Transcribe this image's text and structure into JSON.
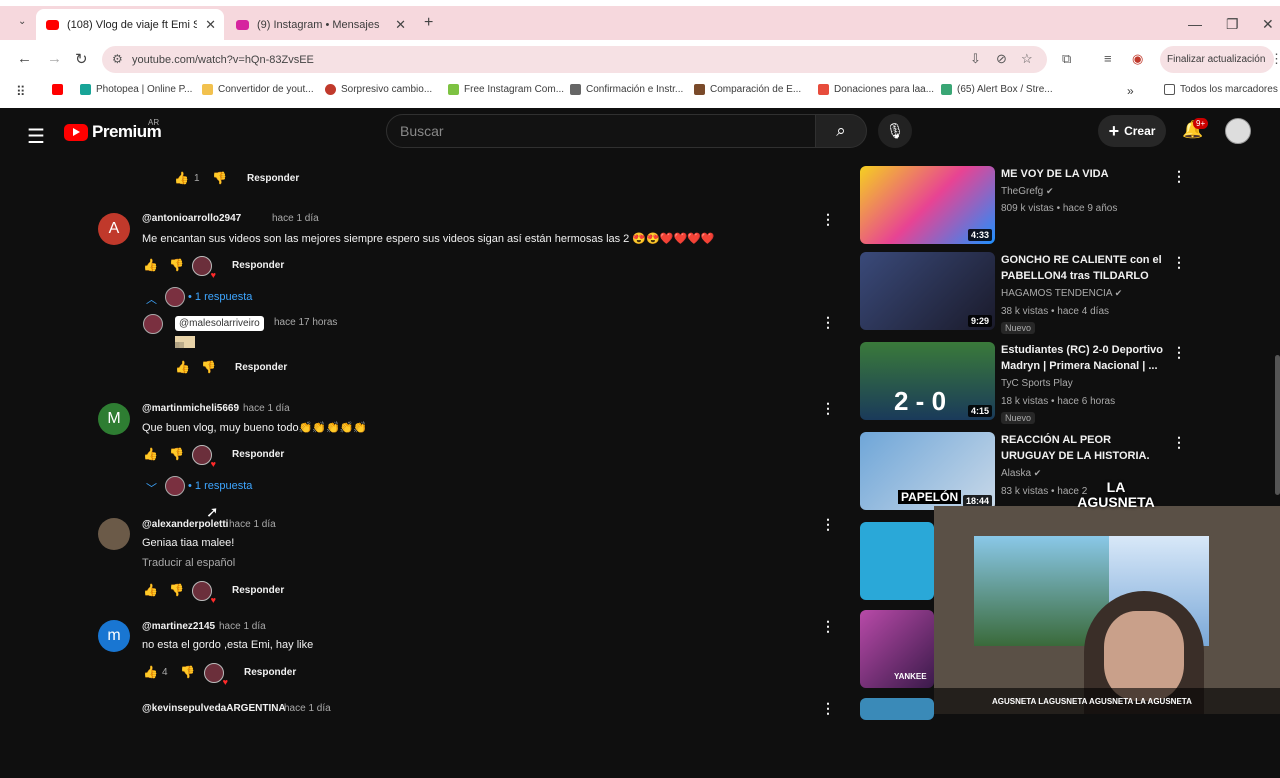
{
  "browser": {
    "tabs": [
      {
        "title": "(108) Vlog de viaje ft Emi Solar",
        "active": true,
        "favicon_color": "#ff0000"
      },
      {
        "title": "(9) Instagram • Mensajes",
        "active": false,
        "favicon_color": "#d6249f"
      }
    ],
    "url": "youtube.com/watch?v=hQn-83ZvsEE",
    "update_button": "Finalizar actualización",
    "bookmarks": [
      "Photopea | Online P...",
      "Convertidor de yout...",
      "Sorpresivo cambio...",
      "Free Instagram Com...",
      "Confirmación e Instr...",
      "Comparación de E...",
      "Donaciones para laa...",
      "(65) Alert Box / Stre..."
    ],
    "all_bookmarks": "Todos los marcadores"
  },
  "youtube": {
    "logo_text": "Premium",
    "region": "AR",
    "search_placeholder": "Buscar",
    "create_label": "Crear",
    "notif_badge": "9+"
  },
  "comments": [
    {
      "top_reply_likes": "1",
      "reply_label": "Responder"
    },
    {
      "author": "@antonioarrollo2947",
      "time": "hace 1 día",
      "text": "Me encantan sus videos son las mejores siempre espero sus videos sigan así están hermosas las 2 😍😍❤️❤️❤️❤️",
      "reply_label": "Responder",
      "replies_label": "1 respuesta",
      "avatar_letter": "A",
      "avatar_color": "#c0392b",
      "reply": {
        "mention": "@malesolarriveiro",
        "time": "hace 17 horas",
        "text": "🏽",
        "reply_label": "Responder"
      }
    },
    {
      "author": "@martinmicheli5669",
      "time": "hace 1 día",
      "text": "Que buen vlog, muy bueno todo👏👏👏👏👏",
      "reply_label": "Responder",
      "replies_label": "1 respuesta",
      "avatar_letter": "M",
      "avatar_color": "#2e7d32"
    },
    {
      "author": "@alexanderpoletti",
      "time": "hace 1 día",
      "text": "Geniaa tiaa malee!",
      "translate": "Traducir al español",
      "reply_label": "Responder"
    },
    {
      "author": "@martinez2145",
      "time": "hace 1 día",
      "text": "no esta el gordo ,esta Emi, hay like",
      "likes": "4",
      "reply_label": "Responder",
      "avatar_letter": "m",
      "avatar_color": "#1976d2"
    },
    {
      "author": "@kevinsepulvedaARGENTINA",
      "time": "hace 1 día"
    }
  ],
  "related": [
    {
      "title": "ME VOY DE LA VIDA",
      "channel": "TheGrefg",
      "meta": "809 k vistas • hace 9 años",
      "duration": "4:33",
      "new": "",
      "thumb_color": "#e0a020"
    },
    {
      "title": "GONCHO RE CALIENTE con el PABELLON4 tras TILDARLO de...",
      "channel": "HAGAMOS TENDENCIA",
      "meta": "38 k vistas • hace 4 días",
      "duration": "9:29",
      "new": "Nuevo",
      "thumb_color": "#2a3a6a"
    },
    {
      "title": "Estudiantes (RC) 2-0 Deportivo Madryn | Primera Nacional | ...",
      "channel": "TyC Sports Play",
      "meta": "18 k vistas • hace 6 horas",
      "duration": "4:15",
      "new": "Nuevo",
      "thumb_color": "#2d5a2a",
      "score": "2 - 0"
    },
    {
      "title": "REACCIÓN AL PEOR URUGUAY DE LA HISTORIA. (5-1 vs USA)",
      "channel": "Alaska",
      "meta": "83 k vistas • hace 2",
      "duration": "18:44",
      "new": "",
      "thumb_color": "#6fa6d8",
      "overlay": "PAPELÓN"
    }
  ],
  "webcam": {
    "overlay": "LA AGUSNETA",
    "socials": "AGUSNETA  LAGUSNETA  AGUSNETA  LA AGUSNETA",
    "yankee": "YANKEE"
  }
}
